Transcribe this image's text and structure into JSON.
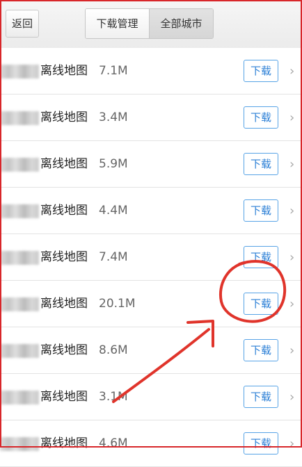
{
  "topbar": {
    "back_label": "返回",
    "tabs": [
      {
        "label": "下载管理",
        "active": false
      },
      {
        "label": "全部城市",
        "active": true
      }
    ]
  },
  "rows": [
    {
      "name": "离线地图",
      "size": "7.1M",
      "button": "下载"
    },
    {
      "name": "离线地图",
      "size": "3.4M",
      "button": "下载"
    },
    {
      "name": "离线地图",
      "size": "5.9M",
      "button": "下载"
    },
    {
      "name": "离线地图",
      "size": "4.4M",
      "button": "下载"
    },
    {
      "name": "离线地图",
      "size": "7.4M",
      "button": "下载"
    },
    {
      "name": "离线地图",
      "size": "20.1M",
      "button": "下载"
    },
    {
      "name": "离线地图",
      "size": "8.6M",
      "button": "下载"
    },
    {
      "name": "离线地图",
      "size": "3.1M",
      "button": "下载"
    },
    {
      "name": "离线地图",
      "size": "4.6M",
      "button": "下载"
    }
  ],
  "icons": {
    "row_chevron": "chevron-right-icon"
  },
  "colors": {
    "accent": "#2b7fd6",
    "annotation": "#e0342b"
  }
}
